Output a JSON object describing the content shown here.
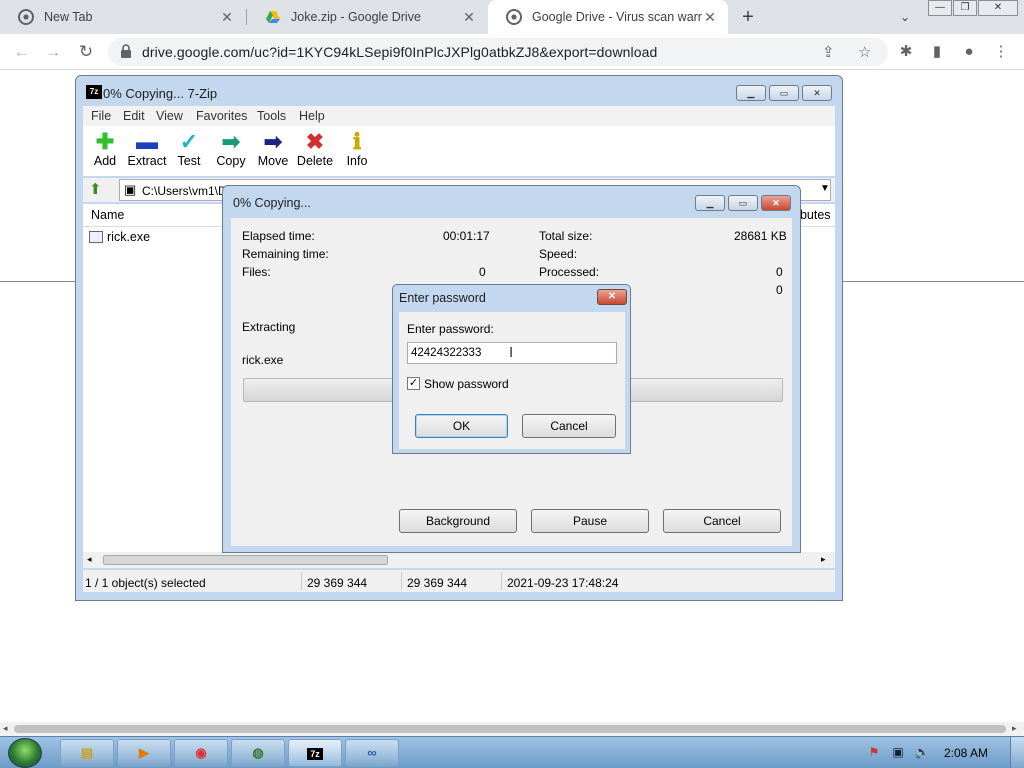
{
  "browser": {
    "tabs": [
      {
        "title": "New Tab",
        "icon": "chrome-icon",
        "active": false
      },
      {
        "title": "Joke.zip - Google Drive",
        "icon": "google-drive-icon",
        "active": false
      },
      {
        "title": "Google Drive - Virus scan warnin",
        "icon": "chrome-icon",
        "active": true
      }
    ],
    "new_tab_label": "+",
    "url": "drive.google.com/uc?id=1KYC94kLSepi9f0InPlcJXPlg0atbkZJ8&export=download"
  },
  "zip_window": {
    "title": "0% Copying... 7-Zip",
    "icon_text": "7z",
    "menu": [
      "File",
      "Edit",
      "View",
      "Favorites",
      "Tools",
      "Help"
    ],
    "toolbar": [
      {
        "label": "Add",
        "icon": "plus-icon",
        "color": "#2fbf2f",
        "glyph": "✚"
      },
      {
        "label": "Extract",
        "icon": "minus-icon",
        "color": "#1f3fbf",
        "glyph": "▬"
      },
      {
        "label": "Test",
        "icon": "check-icon",
        "color": "#1bb5c9",
        "glyph": "✓"
      },
      {
        "label": "Copy",
        "icon": "copy-arrow-icon",
        "color": "#1a9a7a",
        "glyph": "➡"
      },
      {
        "label": "Move",
        "icon": "move-arrow-icon",
        "color": "#1a237e",
        "glyph": "➡"
      },
      {
        "label": "Delete",
        "icon": "delete-x-icon",
        "color": "#d32f2f",
        "glyph": "✖"
      },
      {
        "label": "Info",
        "icon": "info-icon",
        "color": "#c9a800",
        "glyph": "ℹ"
      }
    ],
    "address": "C:\\Users\\vm1\\D",
    "columns": {
      "name": "Name",
      "attributes": "ributes"
    },
    "files": [
      {
        "name": "rick.exe"
      }
    ],
    "status": {
      "selected": "1 / 1 object(s) selected",
      "size": "29 369 344",
      "packed": "29 369 344",
      "modified": "2021-09-23 17:48:24"
    }
  },
  "copy_dialog": {
    "title": "0% Copying...",
    "elapsed_label": "Elapsed time:",
    "elapsed_value": "00:01:17",
    "remaining_label": "Remaining time:",
    "files_label": "Files:",
    "files_value": "0",
    "total_size_label": "Total size:",
    "total_size_value": "28681 KB",
    "speed_label": "Speed:",
    "processed_label": "Processed:",
    "processed_value": "0",
    "extra_value": "0",
    "action": "Extracting",
    "current_file": "rick.exe",
    "progress": 0,
    "buttons": {
      "background": "Background",
      "pause": "Pause",
      "cancel": "Cancel"
    }
  },
  "password_dialog": {
    "title": "Enter password",
    "prompt": "Enter password:",
    "password_value": "42424322333",
    "show_password_label": "Show password",
    "show_password_checked": true,
    "ok": "OK",
    "cancel": "Cancel"
  },
  "taskbar": {
    "clock": "2:08 AM",
    "apps": [
      {
        "name": "explorer",
        "icon": "folder-icon"
      },
      {
        "name": "media-player",
        "icon": "media-player-icon"
      },
      {
        "name": "chrome",
        "icon": "chrome-icon"
      },
      {
        "name": "network",
        "icon": "network-icon"
      },
      {
        "name": "7zip",
        "icon": "7zip-icon",
        "label": "7z"
      },
      {
        "name": "remote",
        "icon": "remote-icon"
      }
    ]
  }
}
